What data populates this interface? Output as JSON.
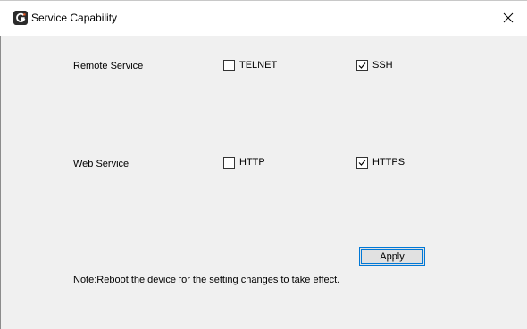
{
  "window": {
    "title": "Service Capability",
    "app_icon": "app-logo-icon",
    "close_icon": "close-icon"
  },
  "remote_service": {
    "label": "Remote Service",
    "options": [
      {
        "label": "TELNET",
        "checked": false
      },
      {
        "label": "SSH",
        "checked": true
      }
    ]
  },
  "web_service": {
    "label": "Web Service",
    "options": [
      {
        "label": "HTTP",
        "checked": false
      },
      {
        "label": "HTTPS",
        "checked": true
      }
    ]
  },
  "apply_label": "Apply",
  "note": "Note:Reboot the device for the setting changes to take effect.",
  "colors": {
    "accent": "#0078d7",
    "background": "#f0f0f0"
  }
}
